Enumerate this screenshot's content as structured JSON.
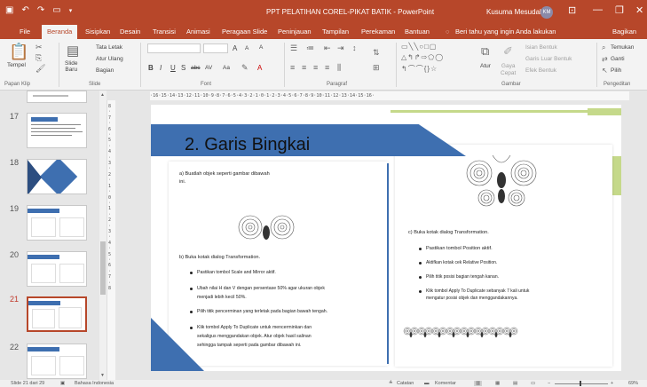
{
  "titlebar": {
    "qat_icons": [
      "save-icon",
      "undo-icon",
      "redo-icon",
      "start-slideshow-icon",
      "customize-qat-icon"
    ],
    "title": "PPT PELATIHAN COREL-PIKAT BATIK  -  PowerPoint",
    "user": "Kusuma Mesudah",
    "avatar_initials": "KM",
    "bg_color": "#b7472a"
  },
  "tabs": [
    "File",
    "Beranda",
    "Sisipkan",
    "Desain",
    "Transisi",
    "Animasi",
    "Peragaan Slide",
    "Peninjauan",
    "Tampilan",
    "Perekaman",
    "Bantuan"
  ],
  "active_tab": "Beranda",
  "tell_me": "Beri tahu yang ingin Anda lakukan",
  "share": "Bagikan",
  "ribbon": {
    "clipboard": {
      "paste": "Tempel",
      "label": "Papan Klip"
    },
    "slides": {
      "new_slide": "Slide\nBaru",
      "layout": "Tata Letak",
      "reset": "Atur Ulang",
      "section": "Bagian",
      "label": "Slide"
    },
    "font": {
      "bold": "B",
      "italic": "I",
      "underline": "U",
      "strike": "S",
      "shadow": "abc",
      "spacing": "AV",
      "case": "Aa",
      "clear": "A",
      "color": "A",
      "grow": "A",
      "shrink": "A",
      "label": "Font"
    },
    "paragraph": {
      "label": "Paragraf"
    },
    "drawing": {
      "arrange": "Atur",
      "quick_styles": "Gaya\nCepat",
      "fill": "Isian Bentuk",
      "outline": "Garis Luar Bentuk",
      "effects": "Efek Bentuk",
      "label": "Gambar"
    },
    "editing": {
      "find": "Temukan",
      "replace": "Ganti",
      "select": "Pilih",
      "label": "Pengeditan"
    }
  },
  "ruler_top": "·16·15·14·13·12·11·10·9·8·7·6·5·4·3·2·1·0·1·2·3·4·5·6·7·8·9·10·11·12·13·14·15·16·",
  "ruler_left": "8·7·6·5·4·3·2·1·0·1·2·3·4·5·6·7·8",
  "thumbnails": [
    {
      "num": "17"
    },
    {
      "num": "18"
    },
    {
      "num": "19"
    },
    {
      "num": "20"
    },
    {
      "num": "21"
    },
    {
      "num": "22"
    }
  ],
  "active_slide": "21",
  "slide": {
    "title": "2. Garis Bingkai",
    "left": {
      "step_a": "a)  Buatlah objek seperti gambar dibawah",
      "step_a2": "ini.",
      "step_b": "b)  Buka kotak dialog Transformation.",
      "bullets": [
        "Pastikan tombol Scale and Mirror aktif.",
        "Ubah nilai H dan V dengan persentase 50% agar ukuran objek",
        "menjadi lebih kecil 50%.",
        "Pilih titik pencerminan yang terletak pada bagian bawah tengah.",
        "Klik tombol Apply To Duplicate untuk mencerminkan dan",
        "sekaligus menggandakan objek. Atur objek hasil salinan",
        "sehingga  tampak seperti pada gambar dibawah ini."
      ]
    },
    "right": {
      "step_c": "c)  Buka kotak dialog Transformation.",
      "bullets": [
        "Pastikan tombol Position aktif.",
        "Aktifkan kotak cek Relative Position.",
        "Pilih titik posisi bagian tengah kanan.",
        "Klik tombol Apply To Duplicate sebanyak 7 kali untuk",
        "mengatur posisi objek dan menggandakannya."
      ]
    },
    "accent_color": "#3e6fb0",
    "green_color": "#c5d98a"
  },
  "status": {
    "slide_info": "Slide 21 dari 29",
    "language": "Bahasa Indonesia",
    "notes": "Catatan",
    "comments": "Komentar",
    "zoom": "69%"
  }
}
